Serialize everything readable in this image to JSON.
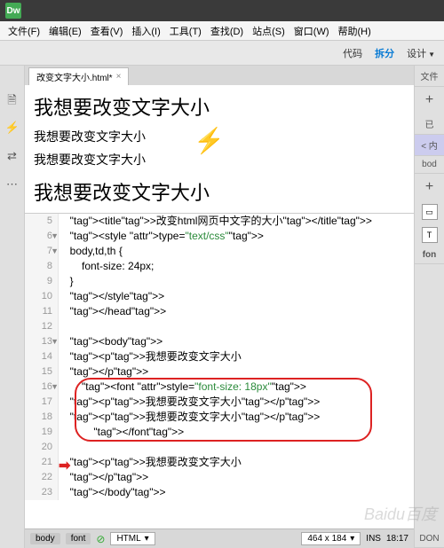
{
  "logo": "Dw",
  "menu": [
    "文件(F)",
    "编辑(E)",
    "查看(V)",
    "插入(I)",
    "工具(T)",
    "查找(D)",
    "站点(S)",
    "窗口(W)",
    "帮助(H)"
  ],
  "toolbar": {
    "code": "代码",
    "split": "拆分",
    "design": "设计"
  },
  "tab": {
    "name": "改变文字大小.html*",
    "close": "×"
  },
  "preview": {
    "l1": "我想要改变文字大小",
    "l2": "我想要改变文字大小",
    "l3": "我想要改变文字大小",
    "l4": "我想要改变文字大小"
  },
  "code": [
    {
      "n": 5,
      "t": "",
      "h": "  <title>改变html网页中文字的大小</title>"
    },
    {
      "n": 6,
      "t": "▼",
      "h": "  <style type=\"text/css\">"
    },
    {
      "n": 7,
      "t": "▼",
      "h": "  body,td,th {"
    },
    {
      "n": 8,
      "t": "",
      "h": "      font-size: 24px;"
    },
    {
      "n": 9,
      "t": "",
      "h": "  }"
    },
    {
      "n": 10,
      "t": "",
      "h": "  </style>"
    },
    {
      "n": 11,
      "t": "",
      "h": "  </head>"
    },
    {
      "n": 12,
      "t": "",
      "h": ""
    },
    {
      "n": 13,
      "t": "▼",
      "h": "  <body>"
    },
    {
      "n": 14,
      "t": "",
      "h": "  <p>我想要改变文字大小"
    },
    {
      "n": 15,
      "t": "",
      "h": "  </p>"
    },
    {
      "n": 16,
      "t": "▼",
      "h": "      <font style=\"font-size: 18px\">"
    },
    {
      "n": 17,
      "t": "",
      "h": "  <p>我想要改变文字大小</p>"
    },
    {
      "n": 18,
      "t": "",
      "h": "  <p>我想要改变文字大小</p>"
    },
    {
      "n": 19,
      "t": "",
      "h": "          </font>"
    },
    {
      "n": 20,
      "t": "",
      "h": ""
    },
    {
      "n": 21,
      "t": "",
      "h": "  <p>我想要改变文字大小"
    },
    {
      "n": 22,
      "t": "",
      "h": "  </p>"
    },
    {
      "n": 23,
      "t": "",
      "h": "  </body>"
    }
  ],
  "status": {
    "crumbs": [
      "body",
      "font"
    ],
    "lang": "HTML",
    "dims": "464 x 184",
    "mode": "INS",
    "time": "18:17"
  },
  "right": {
    "t1": "文件",
    "t2": "已",
    "t3": "< 内",
    "t4": "bod",
    "t5": "fon",
    "t6": "DON"
  },
  "watermark": "Baidu百度"
}
